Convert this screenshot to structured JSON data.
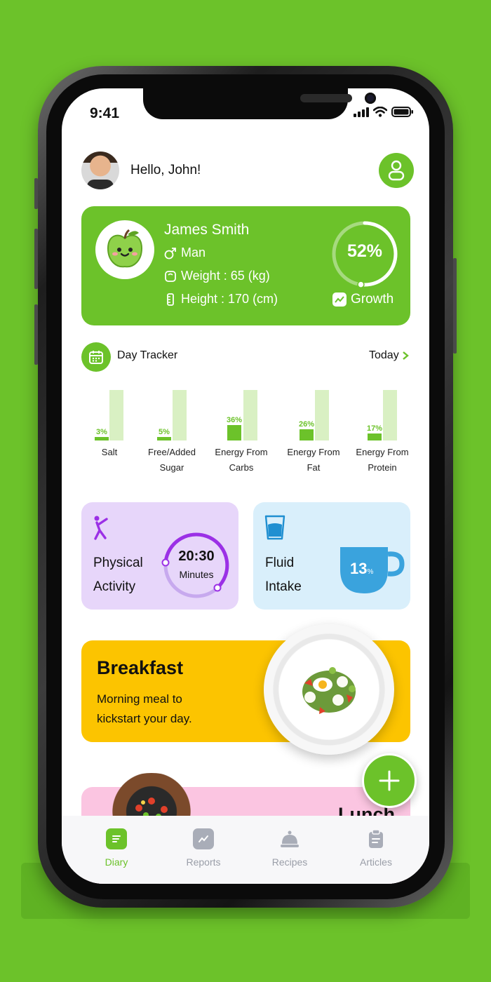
{
  "status_bar": {
    "time": "9:41"
  },
  "header": {
    "greeting": "Hello, John!"
  },
  "profile_card": {
    "name": "James Smith",
    "gender": "Man",
    "weight": "Weight : 65 (kg)",
    "height": "Height : 170 (cm)",
    "growth_percent": "52%",
    "growth_value": 0.52,
    "growth_label": "Growth"
  },
  "day_tracker": {
    "title": "Day Tracker",
    "period": "Today",
    "nutrients": [
      {
        "label_line1": "Salt",
        "label_line2": "",
        "percent_text": "3%",
        "value": 3
      },
      {
        "label_line1": "Free/Added",
        "label_line2": "Sugar",
        "percent_text": "5%",
        "value": 5
      },
      {
        "label_line1": "Energy From",
        "label_line2": "Carbs",
        "percent_text": "36%",
        "value": 36
      },
      {
        "label_line1": "Energy From",
        "label_line2": "Fat",
        "percent_text": "26%",
        "value": 26
      },
      {
        "label_line1": "Energy From",
        "label_line2": "Protein",
        "percent_text": "17%",
        "value": 17
      }
    ]
  },
  "activity": {
    "title_line1": "Physical",
    "title_line2": "Activity",
    "time": "20:30",
    "unit": "Minutes"
  },
  "fluid": {
    "title_line1": "Fluid",
    "title_line2": "Intake",
    "percent": "13",
    "percent_sign": "%"
  },
  "meals": {
    "breakfast": {
      "title": "Breakfast",
      "description": "Morning meal to kickstart your day."
    },
    "lunch": {
      "title": "Lunch"
    }
  },
  "tabbar": {
    "items": [
      {
        "label": "Diary",
        "icon": "diary-icon",
        "active": true
      },
      {
        "label": "Reports",
        "icon": "reports-icon",
        "active": false
      },
      {
        "label": "Recipes",
        "icon": "recipes-icon",
        "active": false
      },
      {
        "label": "Articles",
        "icon": "articles-icon",
        "active": false
      }
    ]
  },
  "colors": {
    "brand_green": "#6cc22a",
    "activity_bg": "#e7d6fa",
    "fluid_bg": "#d9effb",
    "breakfast_bg": "#fcc400",
    "lunch_bg": "#fbc5e1"
  }
}
